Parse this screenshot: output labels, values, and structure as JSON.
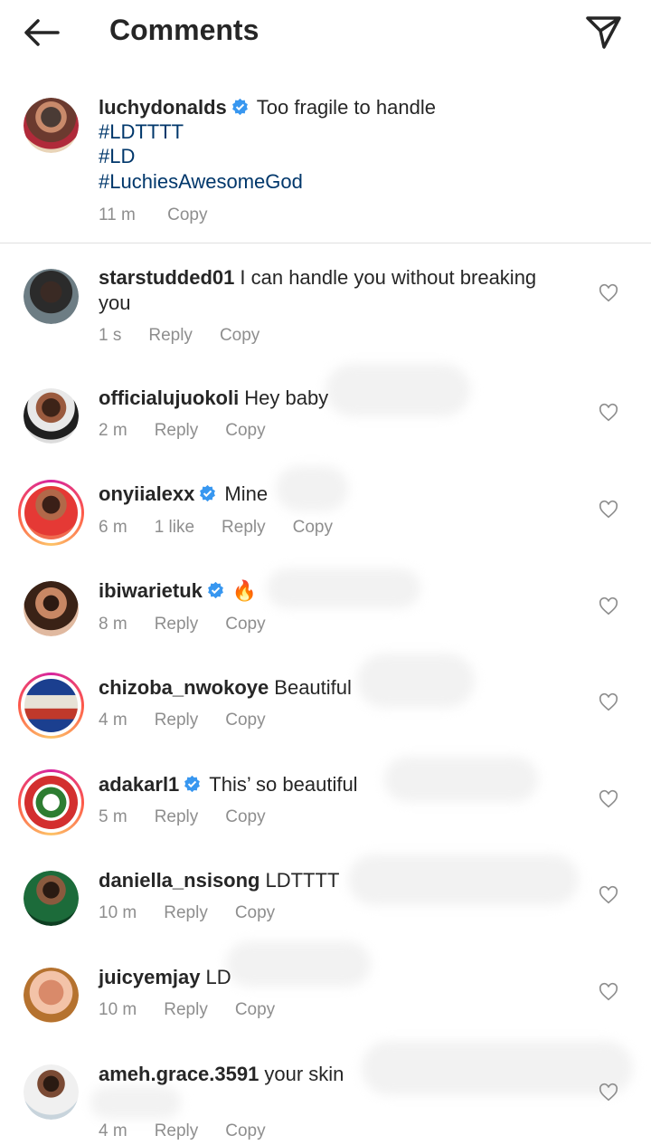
{
  "header": {
    "title": "Comments",
    "back_icon": "back-arrow-icon",
    "share_icon": "paper-plane-icon"
  },
  "caption": {
    "username": "luchydonalds",
    "verified": true,
    "text": "Too fragile to handle",
    "hashtags": [
      "#LDTTTT",
      "#LD",
      "#LuchiesAwesomeGod"
    ],
    "time": "11 m",
    "copy_label": "Copy"
  },
  "comments": [
    {
      "username": "starstudded01",
      "verified": false,
      "text_line1": "I can handle you without breaking",
      "text_line2": "you",
      "time": "1 s",
      "likes": "",
      "reply": "Reply",
      "copy": "Copy"
    },
    {
      "username": "officialujuokoli",
      "verified": false,
      "text_line1": "Hey baby",
      "time": "2 m",
      "likes": "",
      "reply": "Reply",
      "copy": "Copy"
    },
    {
      "username": "onyiialexx",
      "verified": true,
      "text_line1": "Mine",
      "time": "6 m",
      "likes": "1 like",
      "reply": "Reply",
      "copy": "Copy"
    },
    {
      "username": "ibiwarietuk",
      "verified": true,
      "text_line1": "🔥",
      "time": "8 m",
      "likes": "",
      "reply": "Reply",
      "copy": "Copy"
    },
    {
      "username": "chizoba_nwokoye",
      "verified": false,
      "text_line1": "Beautiful",
      "time": "4 m",
      "likes": "",
      "reply": "Reply",
      "copy": "Copy"
    },
    {
      "username": "adakarl1",
      "verified": true,
      "text_line1": "This’ so beautiful",
      "time": "5 m",
      "likes": "",
      "reply": "Reply",
      "copy": "Copy"
    },
    {
      "username": "daniella_nsisong",
      "verified": false,
      "text_line1": "LDTTTT",
      "time": "10 m",
      "likes": "",
      "reply": "Reply",
      "copy": "Copy"
    },
    {
      "username": "juicyemjay",
      "verified": false,
      "text_line1": "LD",
      "time": "10 m",
      "likes": "",
      "reply": "Reply",
      "copy": "Copy"
    },
    {
      "username": "ameh.grace.3591",
      "verified": false,
      "text_line1": "your skin",
      "time": "4 m",
      "likes": "",
      "reply": "Reply",
      "copy": "Copy"
    }
  ],
  "colors": {
    "text": "#262626",
    "meta": "#8e8e8e",
    "hashtag": "#00376b",
    "verified": "#3897f0"
  }
}
